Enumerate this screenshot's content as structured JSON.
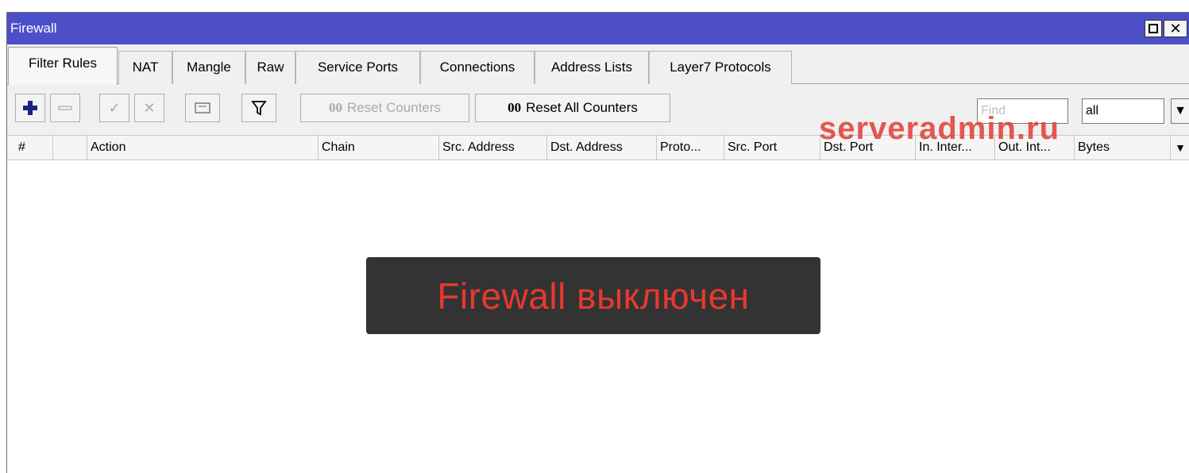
{
  "window": {
    "title": "Firewall"
  },
  "tabs": [
    {
      "label": "Filter Rules",
      "active": true
    },
    {
      "label": "NAT"
    },
    {
      "label": "Mangle"
    },
    {
      "label": "Raw"
    },
    {
      "label": "Service Ports"
    },
    {
      "label": "Connections"
    },
    {
      "label": "Address Lists"
    },
    {
      "label": "Layer7 Protocols"
    }
  ],
  "toolbar": {
    "add_icon": "plus-icon",
    "remove_icon": "minus-icon",
    "enable_icon": "check-icon",
    "disable_icon": "cross-icon",
    "comment_icon": "comment-icon",
    "filter_icon": "funnel-icon",
    "reset_counters_prefix": "00",
    "reset_counters_label": "Reset Counters",
    "reset_all_counters_prefix": "00",
    "reset_all_counters_label": "Reset All Counters",
    "find_placeholder": "Find",
    "filter_value": "all"
  },
  "watermark": "serveradmin.ru",
  "columns": [
    "#",
    "",
    "Action",
    "Chain",
    "Src. Address",
    "Dst. Address",
    "Proto...",
    "Src. Port",
    "Dst. Port",
    "In. Inter...",
    "Out. Int...",
    "Bytes"
  ],
  "banner": {
    "text": "Firewall выключен"
  },
  "colors": {
    "titlebar": "#4d4fc9",
    "add_button": "#1a237e",
    "banner_bg": "#333333",
    "banner_text": "#e8382f"
  }
}
